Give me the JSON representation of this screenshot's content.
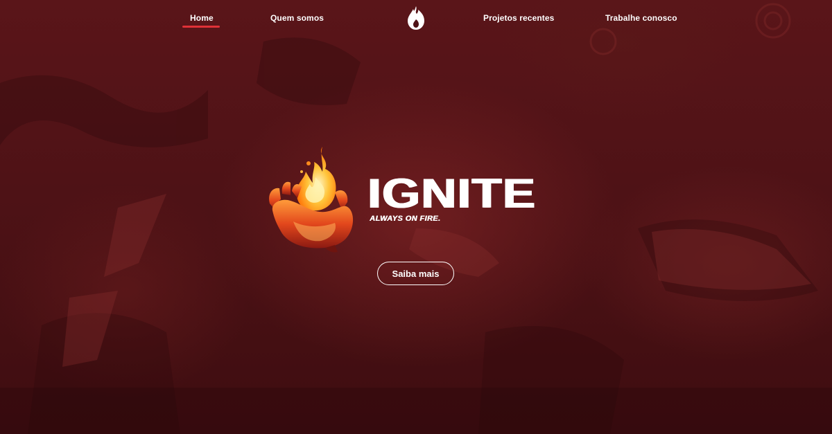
{
  "nav": {
    "items": [
      {
        "label": "Home",
        "active": true
      },
      {
        "label": "Quem somos",
        "active": false
      },
      {
        "label": "Projetos recentes",
        "active": false
      },
      {
        "label": "Trabalhe conosco",
        "active": false
      }
    ],
    "logo_icon": "flame-drop-icon",
    "active_color": "#e03137"
  },
  "hero": {
    "title": "IGNITE",
    "tagline": "ALWAYS ON FIRE.",
    "emblem_icon": "flaming-hand-icon",
    "cta_label": "Saiba mais"
  },
  "colors": {
    "background": "#4e1216",
    "text": "#ffffff",
    "accent": "#e03137"
  }
}
